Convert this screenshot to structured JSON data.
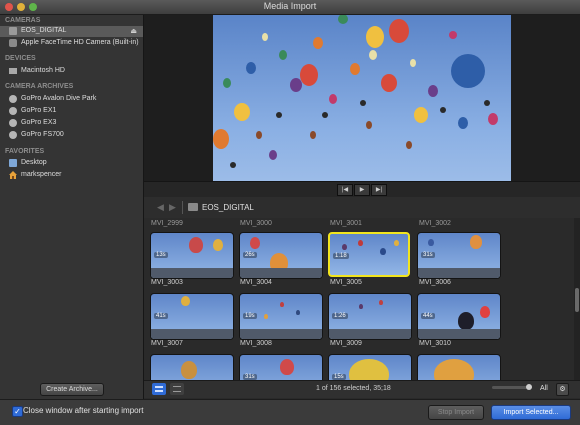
{
  "window": {
    "title": "Media Import"
  },
  "sidebar": {
    "sections": [
      {
        "title": "CAMERAS",
        "items": [
          {
            "label": "EOS_DIGITAL",
            "icon": "camera-card-icon",
            "selected": true
          },
          {
            "label": "Apple FaceTime HD Camera (Built-in)",
            "icon": "webcam-icon"
          }
        ]
      },
      {
        "title": "DEVICES",
        "items": [
          {
            "label": "Macintosh HD",
            "icon": "hard-drive-icon"
          }
        ]
      },
      {
        "title": "CAMERA ARCHIVES",
        "items": [
          {
            "label": "GoPro Avalon Dive Park",
            "icon": "archive-icon"
          },
          {
            "label": "GoPro EX1",
            "icon": "archive-icon"
          },
          {
            "label": "GoPro EX3",
            "icon": "archive-icon"
          },
          {
            "label": "GoPro FS700",
            "icon": "archive-icon"
          }
        ]
      },
      {
        "title": "FAVORITES",
        "items": [
          {
            "label": "Desktop",
            "icon": "desktop-folder-icon"
          },
          {
            "label": "markspencer",
            "icon": "home-icon"
          }
        ]
      }
    ],
    "create_archive_label": "Create Archive..."
  },
  "browser": {
    "current_location": "EOS_DIGITAL",
    "top_row_labels": [
      "MVI_2999",
      "MVI_3000",
      "MVI_3001",
      "MVI_3002"
    ],
    "clips": [
      {
        "name": "MVI_3003",
        "duration": "13s"
      },
      {
        "name": "MVI_3004",
        "duration": "26s"
      },
      {
        "name": "MVI_3005",
        "duration": "1:18",
        "selected": true
      },
      {
        "name": "MVI_3006",
        "duration": "31s"
      },
      {
        "name": "MVI_3007",
        "duration": "41s"
      },
      {
        "name": "MVI_3008",
        "duration": "19s"
      },
      {
        "name": "MVI_3009",
        "duration": "1:26"
      },
      {
        "name": "MVI_3010",
        "duration": "44s"
      },
      {
        "name": "",
        "duration": ""
      },
      {
        "name": "",
        "duration": "31s"
      },
      {
        "name": "",
        "duration": "15s"
      },
      {
        "name": "",
        "duration": ""
      }
    ],
    "status": "1 of 156 selected, 35;18",
    "filter_label": "All"
  },
  "footer": {
    "close_checkbox_label": "Close window after starting import",
    "close_checkbox_checked": true,
    "stop_import_label": "Stop Import",
    "import_selected_label": "Import Selected..."
  },
  "colors": {
    "accent_blue": "#2f6bd6",
    "selection_yellow": "#f2e51e",
    "sky": "#7aa3dc"
  }
}
